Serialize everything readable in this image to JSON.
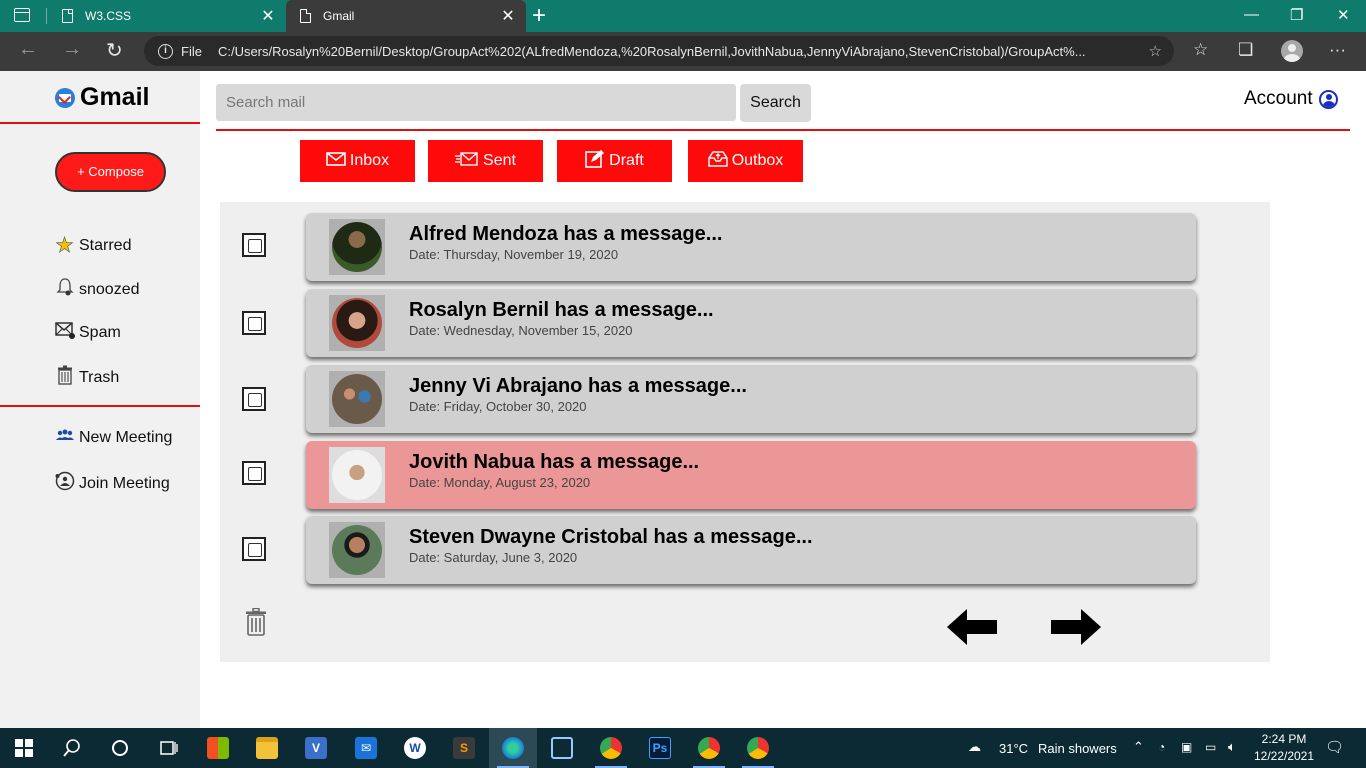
{
  "browser": {
    "tabs": [
      {
        "title": "W3.CSS",
        "active": false
      },
      {
        "title": "Gmail",
        "active": true
      }
    ],
    "address": {
      "scheme_label": "File",
      "url": "C:/Users/Rosalyn%20Bernil/Desktop/GroupAct%202(ALfredMendoza,%20RosalynBernil,JovithNabua,JennyViAbrajano,StevenCristobal)/GroupAct%..."
    }
  },
  "app": {
    "brand": "Gmail",
    "compose_label": "+ Compose",
    "sidebar": {
      "items": [
        {
          "label": "Starred",
          "icon": "star-icon"
        },
        {
          "label": "snoozed",
          "icon": "bell-icon"
        },
        {
          "label": "Spam",
          "icon": "spam-mail-icon"
        },
        {
          "label": "Trash",
          "icon": "trash-icon"
        }
      ],
      "meeting_items": [
        {
          "label": "New Meeting",
          "icon": "people-icon"
        },
        {
          "label": "Join Meeting",
          "icon": "join-meeting-icon"
        }
      ]
    },
    "search": {
      "placeholder": "Search mail",
      "button_label": "Search"
    },
    "account_label": "Account",
    "folders": [
      {
        "label": "Inbox",
        "icon": "envelope-icon"
      },
      {
        "label": "Sent",
        "icon": "sent-icon"
      },
      {
        "label": "Draft",
        "icon": "edit-icon"
      },
      {
        "label": "Outbox",
        "icon": "outbox-icon"
      }
    ],
    "messages": [
      {
        "subject": "Alfred Mendoza has a message...",
        "date": "Date: Thursday, November 19, 2020",
        "highlight": false
      },
      {
        "subject": "Rosalyn Bernil has a message...",
        "date": "Date: Wednesday, November 15, 2020",
        "highlight": false
      },
      {
        "subject": "Jenny Vi Abrajano has a message...",
        "date": "Date: Friday, October 30, 2020",
        "highlight": false
      },
      {
        "subject": "Jovith Nabua has a message...",
        "date": "Date: Monday, August 23, 2020",
        "highlight": true
      },
      {
        "subject": "Steven Dwayne Cristobal has a message...",
        "date": "Date: Saturday, June 3, 2020",
        "highlight": false
      }
    ],
    "colors": {
      "accent": "#ff0a0a",
      "highlight_row": "#ec9797",
      "card": "#d0d0d0"
    }
  },
  "taskbar": {
    "weather": {
      "temp": "31°C",
      "condition": "Rain showers"
    },
    "time": "2:24 PM",
    "date": "12/22/2021"
  }
}
